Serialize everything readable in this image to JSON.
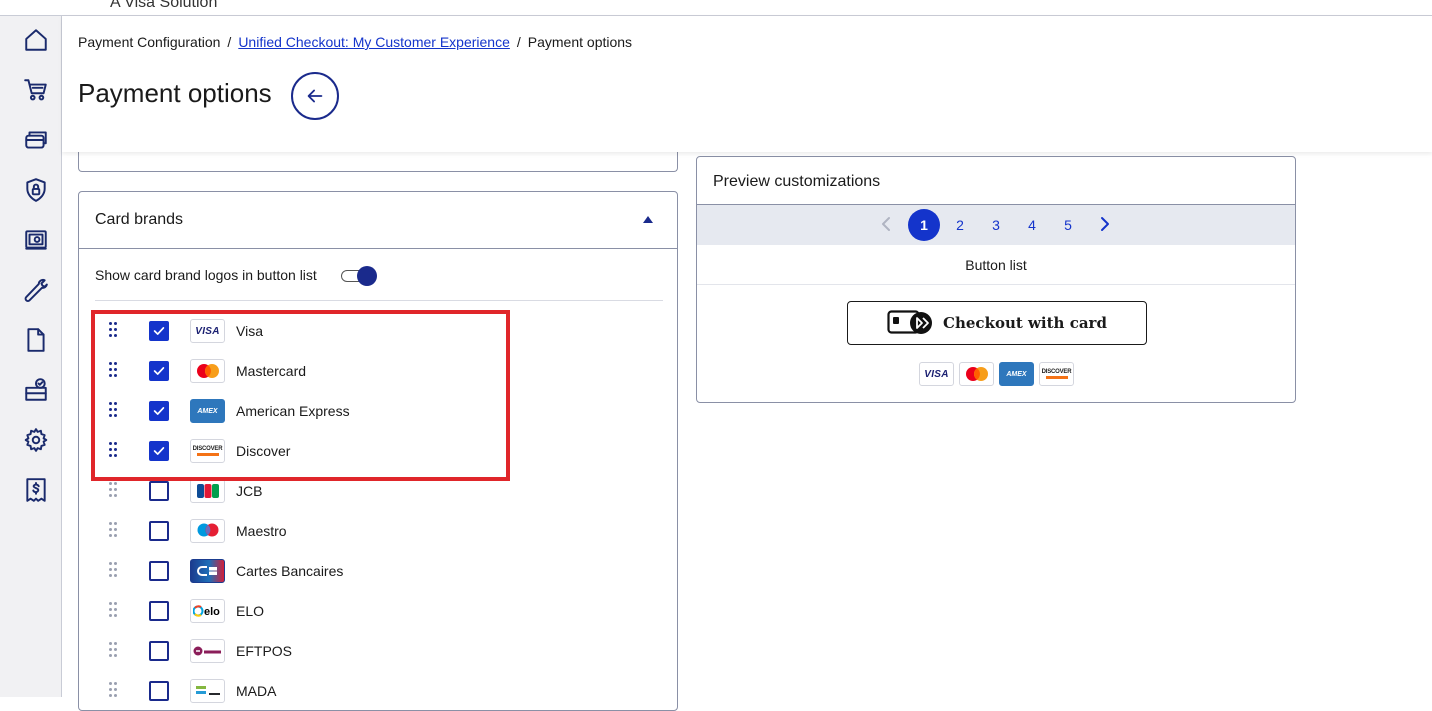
{
  "topbar": {
    "brand_sub": "A Visa Solution"
  },
  "nav": {
    "items": [
      {
        "icon": "home-icon"
      },
      {
        "icon": "cart-icon"
      },
      {
        "icon": "cards-icon"
      },
      {
        "icon": "shield-lock-icon"
      },
      {
        "icon": "safe-icon"
      },
      {
        "icon": "wrench-icon"
      },
      {
        "icon": "document-icon"
      },
      {
        "icon": "inbox-check-icon"
      },
      {
        "icon": "gear-icon"
      },
      {
        "icon": "receipt-icon"
      }
    ]
  },
  "breadcrumb": {
    "item1": "Payment Configuration",
    "sep": "/",
    "item2": "Unified Checkout: My Customer Experience",
    "item3": "Payment options"
  },
  "page": {
    "title": "Payment options"
  },
  "card_brands": {
    "title": "Card brands",
    "toggle_label": "Show card brand logos in button list",
    "toggle_on": true,
    "brands": [
      {
        "name": "Visa",
        "checked": true,
        "logo": "visa-logo"
      },
      {
        "name": "Mastercard",
        "checked": true,
        "logo": "mastercard-logo"
      },
      {
        "name": "American Express",
        "checked": true,
        "logo": "amex-logo"
      },
      {
        "name": "Discover",
        "checked": true,
        "logo": "discover-logo"
      },
      {
        "name": "JCB",
        "checked": false,
        "logo": "jcb-logo"
      },
      {
        "name": "Maestro",
        "checked": false,
        "logo": "maestro-logo"
      },
      {
        "name": "Cartes Bancaires",
        "checked": false,
        "logo": "cartes-bancaires-logo"
      },
      {
        "name": "ELO",
        "checked": false,
        "logo": "elo-logo"
      },
      {
        "name": "EFTPOS",
        "checked": false,
        "logo": "eftpos-logo"
      },
      {
        "name": "MADA",
        "checked": false,
        "logo": "mada-logo"
      }
    ]
  },
  "preview": {
    "title": "Preview customizations",
    "pages": [
      "1",
      "2",
      "3",
      "4",
      "5"
    ],
    "active_page": "1",
    "view_label": "Button list",
    "checkout_label": "Checkout with card",
    "logos": {
      "visa": "VISA",
      "amex": "AMEX",
      "discover": "DISCOVER"
    }
  },
  "colors": {
    "primary": "#1434cb",
    "nav_icon": "#1a2a6c",
    "highlight": "#e0262a"
  }
}
